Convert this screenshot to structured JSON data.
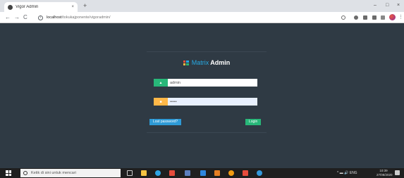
{
  "browser": {
    "tab": {
      "title": "Vigor Admin",
      "close": "×"
    },
    "new_tab": "+",
    "window": {
      "minimize": "–",
      "maximize": "□",
      "close": "×"
    },
    "nav": {
      "back": "←",
      "forward": "→",
      "reload": "C"
    },
    "address": {
      "host": "localhost",
      "path": "/tokukajponente/vigoradmin/"
    },
    "menu": "⋮"
  },
  "login": {
    "brand_a": "Matrix",
    "brand_b": "Admin",
    "brand_colors": [
      "#ef4e3a",
      "#27a9e3",
      "#f6bb42",
      "#28b779"
    ],
    "username": {
      "value": "admin",
      "icon": "user-icon",
      "icon_glyph": "▲",
      "color": "#28b779"
    },
    "password": {
      "value": "•••••",
      "icon": "lock-icon",
      "icon_glyph": "■",
      "color": "#ffb848"
    },
    "lost_password_label": "Lost password?",
    "login_label": "Login",
    "lost_color": "#2e9ad6",
    "login_color": "#28b779"
  },
  "taskbar": {
    "search_placeholder": "Ketik di sini untuk mencari",
    "tray": "^  ▬  🔊 ENG",
    "time": "10:39",
    "date": "27/08/2020"
  },
  "colors": {
    "page_bg": "#2f3a44",
    "taskbar_bg": "#1f1f1f"
  }
}
